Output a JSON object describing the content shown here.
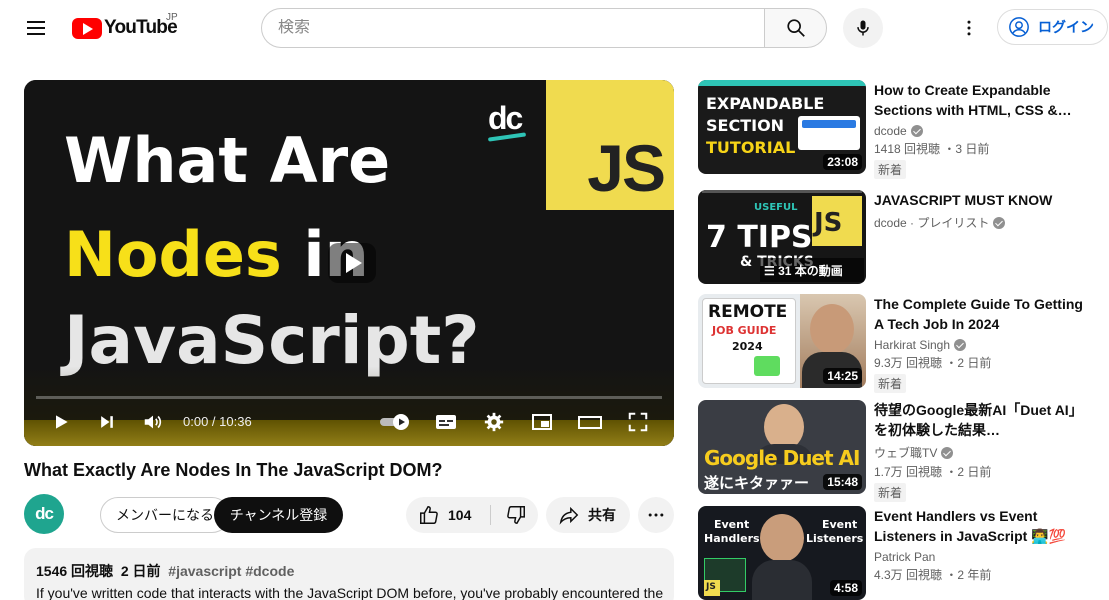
{
  "masthead": {
    "logo_text": "YouTube",
    "country_code": "JP",
    "search_placeholder": "検索",
    "signin_label": "ログイン"
  },
  "player": {
    "thumbnail": {
      "line1": "What Are",
      "line2_highlight": "Nodes",
      "line2_rest": " in",
      "line3": "JavaScript?",
      "badge": "JS",
      "brand": "dc"
    },
    "time": "0:00 / 10:36",
    "progress": 0
  },
  "video": {
    "title": "What Exactly Are Nodes In The JavaScript DOM?",
    "channel_avatar": "dc",
    "member_label": "メンバーになる",
    "subscribe_label": "チャンネル登録",
    "likes": "104",
    "share_label": "共有"
  },
  "description": {
    "views": "1546 回視聴",
    "date": "2 日前",
    "tags": "#javascript #dcode",
    "text": "If you've written code that interacts with the JavaScript DOM before, you've probably encountered the"
  },
  "recommendations": [
    {
      "title": "How to Create Expandable Sections with HTML, CSS &…",
      "channel": "dcode",
      "verified": true,
      "stats": "1418 回視聴 ・3 日前",
      "badge": "新着",
      "duration": "23:08",
      "thumb_lines": [
        "EXPANDABLE",
        "SECTION",
        "TUTORIAL"
      ]
    },
    {
      "title": "JAVASCRIPT MUST KNOW",
      "channel": "dcode · プレイリスト",
      "verified": true,
      "stats": "",
      "badge": "",
      "duration": "31 本の動画",
      "thumb_lines": [
        "USEFUL",
        "7 TIPS",
        "& TRICKS",
        "JS"
      ]
    },
    {
      "title": "The Complete Guide To Getting A Tech Job In 2024",
      "channel": "Harkirat Singh",
      "verified": true,
      "stats": "9.3万 回視聴 ・2 日前",
      "badge": "新着",
      "duration": "14:25",
      "thumb_lines": [
        "REMOTE",
        "JOB GUIDE",
        "2024"
      ]
    },
    {
      "title": "待望のGoogle最新AI「Duet AI」を初体験した結果…",
      "channel": "ウェブ職TV",
      "verified": true,
      "stats": "1.7万 回視聴 ・2 日前",
      "badge": "新着",
      "duration": "15:48",
      "thumb_lines": [
        "Google Duet AI",
        "遂にキタァァー"
      ]
    },
    {
      "title": "Event Handlers vs Event Listeners in JavaScript 👨‍💻💯",
      "channel": "Patrick Pan",
      "verified": false,
      "stats": "4.3万 回視聴 ・2 年前",
      "badge": "",
      "duration": "4:58",
      "thumb_lines": [
        "Event",
        "Handlers",
        "Event",
        "Listeners",
        "JS"
      ]
    }
  ],
  "colors": {
    "brand_red": "#ff0000",
    "js_yellow": "#f0db4f",
    "link_blue": "#065fd4"
  }
}
